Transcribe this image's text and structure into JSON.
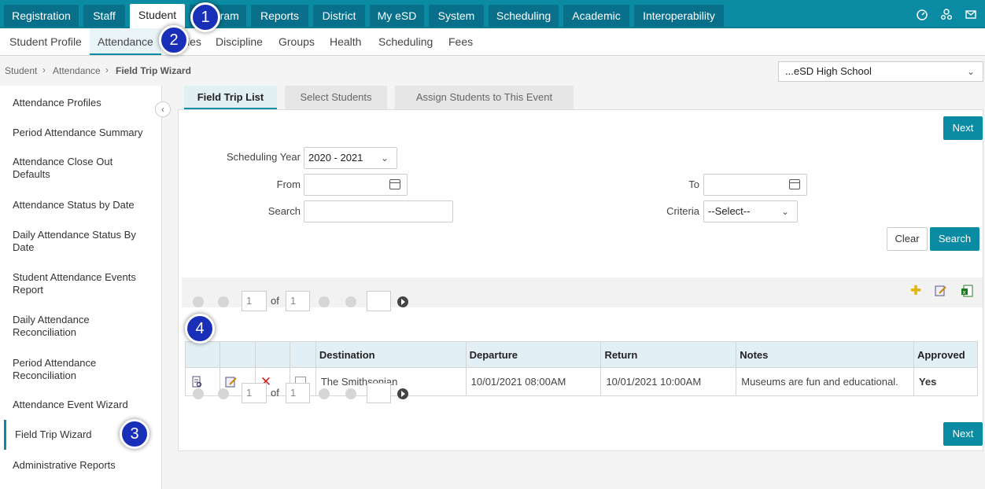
{
  "top_nav": {
    "tabs": [
      {
        "label": "Registration",
        "active": false
      },
      {
        "label": "Staff",
        "active": false
      },
      {
        "label": "Student",
        "active": true
      },
      {
        "label": "Program",
        "active": false
      },
      {
        "label": "Reports",
        "active": false
      },
      {
        "label": "District",
        "active": false
      },
      {
        "label": "My eSD",
        "active": false
      },
      {
        "label": "System",
        "active": false
      },
      {
        "label": "Scheduling",
        "active": false
      },
      {
        "label": "Academic",
        "active": false
      },
      {
        "label": "Interoperability",
        "active": false
      }
    ],
    "icons": [
      "dashboard-icon",
      "users-icon",
      "mail-icon"
    ]
  },
  "sub_nav": {
    "tabs": [
      "Student Profile",
      "Attendance",
      "Grades",
      "Discipline",
      "Groups",
      "Health",
      "Scheduling",
      "Fees"
    ],
    "active": "Attendance"
  },
  "breadcrumb": [
    "Student",
    "Attendance",
    "Field Trip Wizard"
  ],
  "school_select": {
    "value": "...eSD High School"
  },
  "sidebar": {
    "items": [
      "Attendance Profiles",
      "Period Attendance Summary",
      "Attendance Close Out Defaults",
      "Attendance Status by Date",
      "Daily Attendance Status By Date",
      "Student Attendance Events Report",
      "Daily Attendance Reconciliation",
      "Period Attendance Reconciliation",
      "Attendance Event Wizard",
      "Field Trip Wizard",
      "Administrative Reports"
    ],
    "active": "Field Trip Wizard"
  },
  "wizard_tabs": [
    "Field Trip List",
    "Select Students",
    "Assign Students to This Event"
  ],
  "buttons": {
    "next": "Next",
    "clear": "Clear",
    "search": "Search"
  },
  "filters": {
    "scheduling_year_label": "Scheduling Year",
    "scheduling_year_value": "2020 - 2021",
    "from_label": "From",
    "to_label": "To",
    "search_label": "Search",
    "criteria_label": "Criteria",
    "criteria_value": "--Select--"
  },
  "pager": {
    "page": "1",
    "of_label": "of",
    "total": "1"
  },
  "table": {
    "columns": [
      "",
      "",
      "",
      "",
      "Destination",
      "Departure",
      "Return",
      "Notes",
      "Approved"
    ],
    "rows": [
      {
        "destination": "The Smithsonian",
        "departure": "10/01/2021 08:00AM",
        "return": "10/01/2021 10:00AM",
        "notes": "Museums are fun and educational.",
        "approved": "Yes"
      }
    ]
  },
  "callouts": [
    "1",
    "2",
    "3",
    "4"
  ],
  "colors": {
    "primary": "#0a8aa3",
    "callout": "#1a2fb8"
  }
}
